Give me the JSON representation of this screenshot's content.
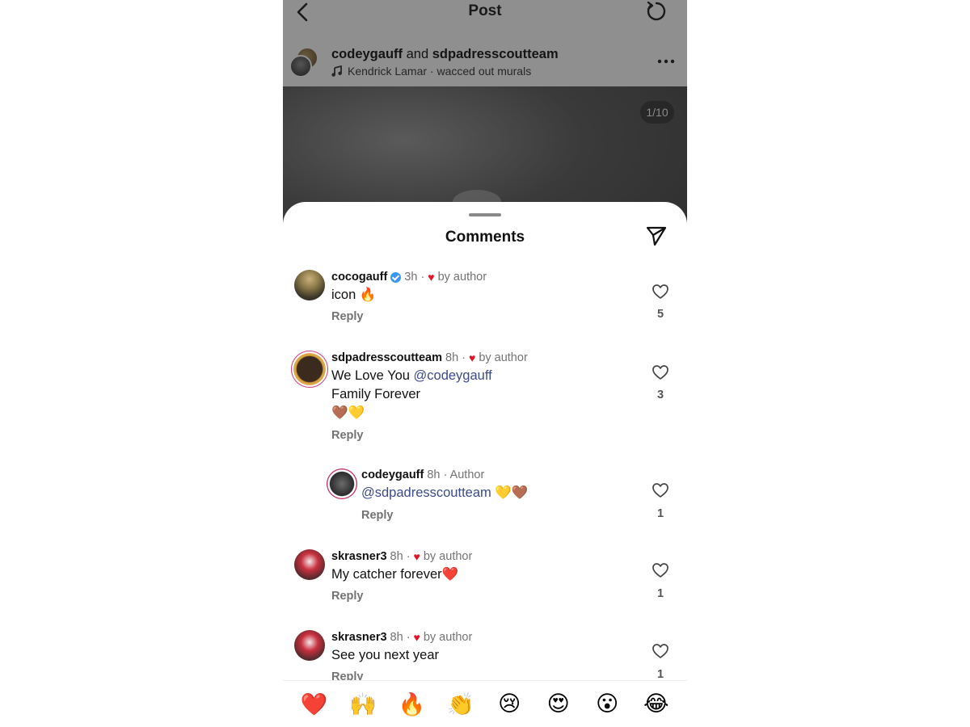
{
  "header": {
    "title": "Post",
    "back_icon": "chevron-left-icon",
    "refresh_icon": "refresh-icon"
  },
  "post": {
    "author1": "codeygauff",
    "conjunction": "and",
    "author2": "sdpadresscoutteam",
    "music": "Kendrick Lamar · wacced out murals",
    "slide_counter": "1/10"
  },
  "sheet": {
    "title": "Comments",
    "share_icon": "send-icon"
  },
  "comments": [
    {
      "username": "cocogauff",
      "verified": true,
      "time": "3h ·",
      "badge": "by author",
      "lines": [
        "icon 🔥"
      ],
      "reply": "Reply",
      "likes": "5"
    },
    {
      "username": "sdpadresscoutteam",
      "verified": false,
      "time": "8h ·",
      "badge": "by author",
      "line1_text": "We Love You ",
      "line1_mention": "@codeygauff",
      "line2": "Family Forever",
      "line3": "🤎💛",
      "reply": "Reply",
      "likes": "3"
    },
    {
      "username": "codeygauff",
      "verified": false,
      "time": "8h · Author",
      "mention": "@sdpadresscoutteam",
      "tail": " 💛🤎",
      "reply": "Reply",
      "likes": "1"
    },
    {
      "username": "skrasner3",
      "verified": false,
      "time": "8h ·",
      "badge": "by author",
      "lines": [
        "My catcher forever❤️"
      ],
      "reply": "Reply",
      "likes": "1"
    },
    {
      "username": "skrasner3",
      "verified": false,
      "time": "8h ·",
      "badge": "by author",
      "lines": [
        "See you next year"
      ],
      "reply": "Reply",
      "likes": "1"
    }
  ],
  "quick_reactions": [
    "❤️",
    "🙌",
    "🔥",
    "👏",
    "😢",
    "😍",
    "😮",
    "😂"
  ],
  "colors": {
    "mention": "#3b4a88",
    "heart": "#e0152a",
    "verified": "#3897f0",
    "overlay": "#8f8f8f"
  }
}
